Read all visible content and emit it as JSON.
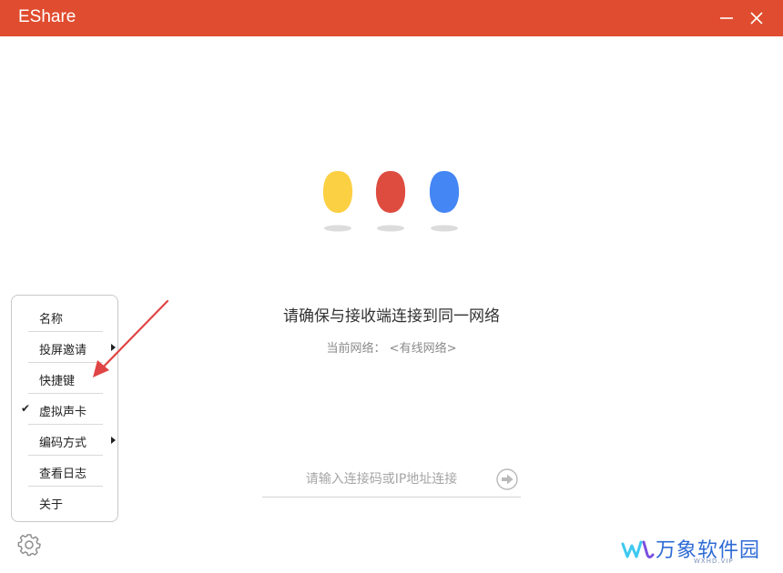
{
  "window": {
    "title": "EShare",
    "titlebar_color": "#e04c2f",
    "minimize_icon": "minimize-icon",
    "close_icon": "close-icon"
  },
  "logo": {
    "dot_colors": [
      "#fcd043",
      "#de4c40",
      "#4486f4"
    ],
    "shadow_color": "#dcdcdc"
  },
  "main": {
    "headline": "请确保与接收端连接到同一网络",
    "network_label": "当前网络：",
    "network_value": "<有线网络>"
  },
  "connect": {
    "placeholder": "请输入连接码或IP地址连接",
    "go_icon": "arrow-right-circle-icon"
  },
  "menu": {
    "items": [
      {
        "label": "名称",
        "checked": false,
        "submenu": false
      },
      {
        "label": "投屏邀请",
        "checked": false,
        "submenu": true
      },
      {
        "label": "快捷键",
        "checked": false,
        "submenu": false
      },
      {
        "label": "虚拟声卡",
        "checked": true,
        "submenu": false
      },
      {
        "label": "编码方式",
        "checked": false,
        "submenu": true
      },
      {
        "label": "查看日志",
        "checked": false,
        "submenu": false
      },
      {
        "label": "关于",
        "checked": false,
        "submenu": false
      }
    ],
    "check_glyph": "✔"
  },
  "settings": {
    "icon": "gear-icon"
  },
  "annotation": {
    "color": "#e04545"
  },
  "watermark": {
    "text": "万象软件园",
    "sub": "WXHD.VIP",
    "color": "#2e6bd6"
  }
}
